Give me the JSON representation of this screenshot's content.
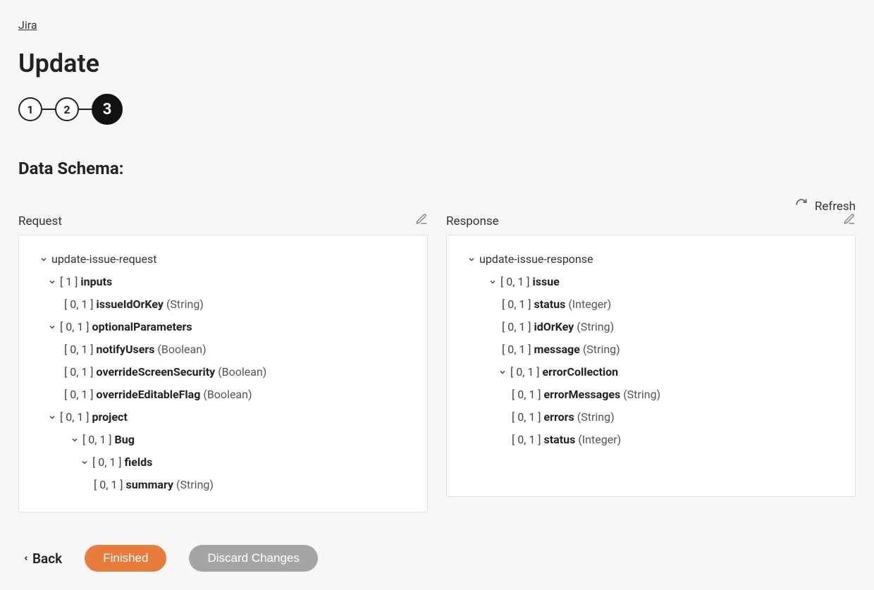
{
  "breadcrumb": "Jira",
  "title": "Update",
  "steps": {
    "s1": "1",
    "s2": "2",
    "s3": "3"
  },
  "section_title": "Data Schema:",
  "refresh_label": "Refresh",
  "request": {
    "label": "Request",
    "root": "update-issue-request",
    "inputs": {
      "card": "[ 1 ]",
      "name": "inputs",
      "items": {
        "issueIdOrKey": {
          "card": "[ 0, 1 ]",
          "name": "issueIdOrKey",
          "type": "(String)"
        }
      }
    },
    "optionalParameters": {
      "card": "[ 0, 1 ]",
      "name": "optionalParameters",
      "items": {
        "notifyUsers": {
          "card": "[ 0, 1 ]",
          "name": "notifyUsers",
          "type": "(Boolean)"
        },
        "overrideScreenSecurity": {
          "card": "[ 0, 1 ]",
          "name": "overrideScreenSecurity",
          "type": "(Boolean)"
        },
        "overrideEditableFlag": {
          "card": "[ 0, 1 ]",
          "name": "overrideEditableFlag",
          "type": "(Boolean)"
        }
      }
    },
    "project": {
      "card": "[ 0, 1 ]",
      "name": "project",
      "bug": {
        "card": "[ 0, 1 ]",
        "name": "Bug",
        "fields": {
          "card": "[ 0, 1 ]",
          "name": "fields",
          "summary": {
            "card": "[ 0, 1 ]",
            "name": "summary",
            "type": "(String)"
          }
        }
      }
    }
  },
  "response": {
    "label": "Response",
    "root": "update-issue-response",
    "issue": {
      "card": "[ 0, 1 ]",
      "name": "issue",
      "items": {
        "status": {
          "card": "[ 0, 1 ]",
          "name": "status",
          "type": "(Integer)"
        },
        "idOrKey": {
          "card": "[ 0, 1 ]",
          "name": "idOrKey",
          "type": "(String)"
        },
        "message": {
          "card": "[ 0, 1 ]",
          "name": "message",
          "type": "(String)"
        }
      }
    },
    "errorCollection": {
      "card": "[ 0, 1 ]",
      "name": "errorCollection",
      "items": {
        "errorMessages": {
          "card": "[ 0, 1 ]",
          "name": "errorMessages",
          "type": "(String)"
        },
        "errors": {
          "card": "[ 0, 1 ]",
          "name": "errors",
          "type": "(String)"
        },
        "status": {
          "card": "[ 0, 1 ]",
          "name": "status",
          "type": "(Integer)"
        }
      }
    }
  },
  "footer": {
    "back": "Back",
    "finished": "Finished",
    "discard": "Discard Changes"
  }
}
